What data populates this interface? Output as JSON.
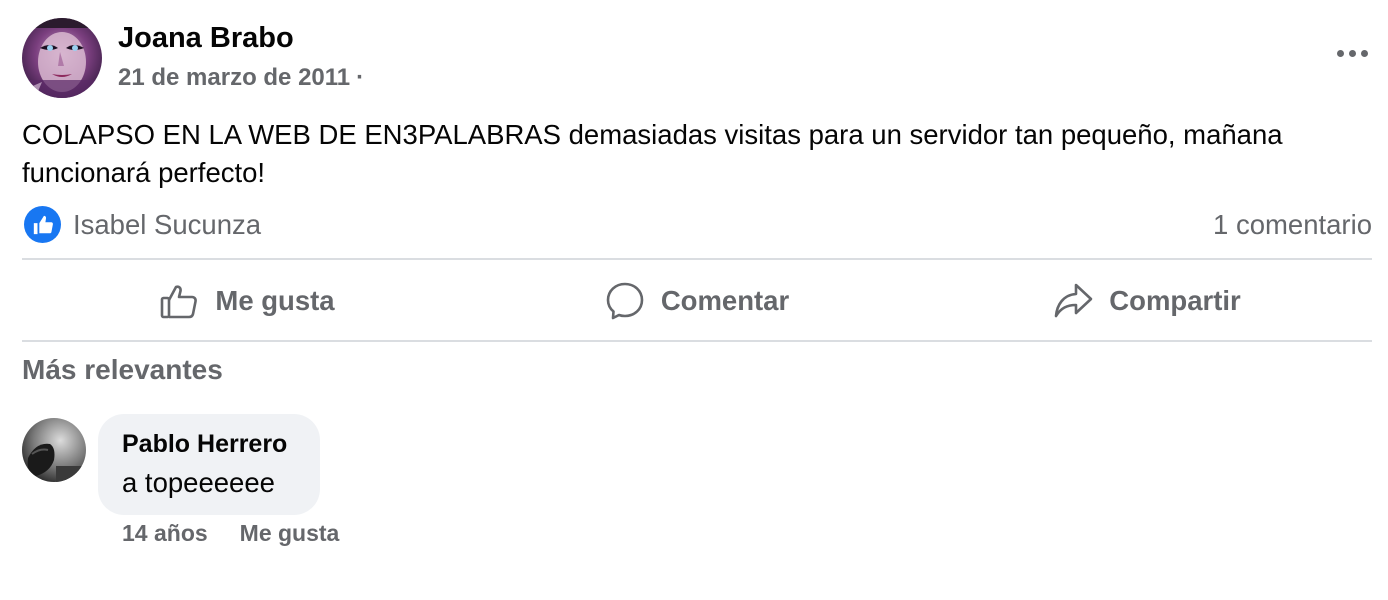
{
  "post": {
    "author": "Joana Brabo",
    "date": "21 de marzo de 2011",
    "separator": "·",
    "text": "COLAPSO EN LA WEB DE EN3PALABRAS demasiadas visitas para un servidor tan pequeño, mañana funcionará perfecto!",
    "reactions": {
      "type": "like",
      "names": "Isabel Sucunza"
    },
    "comment_count": "1 comentario"
  },
  "actions": {
    "like": "Me gusta",
    "comment": "Comentar",
    "share": "Compartir"
  },
  "comments": {
    "sort_label": "Más relevantes",
    "items": [
      {
        "author": "Pablo Herrero",
        "text": "a topeeeeee",
        "age": "14 años",
        "like": "Me gusta"
      }
    ]
  },
  "colors": {
    "accent": "#1877f2",
    "secondary_text": "#65676b",
    "bubble": "#f0f2f5",
    "divider": "#dadde1"
  },
  "icons": {
    "more": "more-dots-icon",
    "like_badge": "thumbs-up-icon",
    "like_action": "thumbs-up-outline-icon",
    "comment_action": "speech-bubble-icon",
    "share_action": "share-arrow-icon"
  }
}
